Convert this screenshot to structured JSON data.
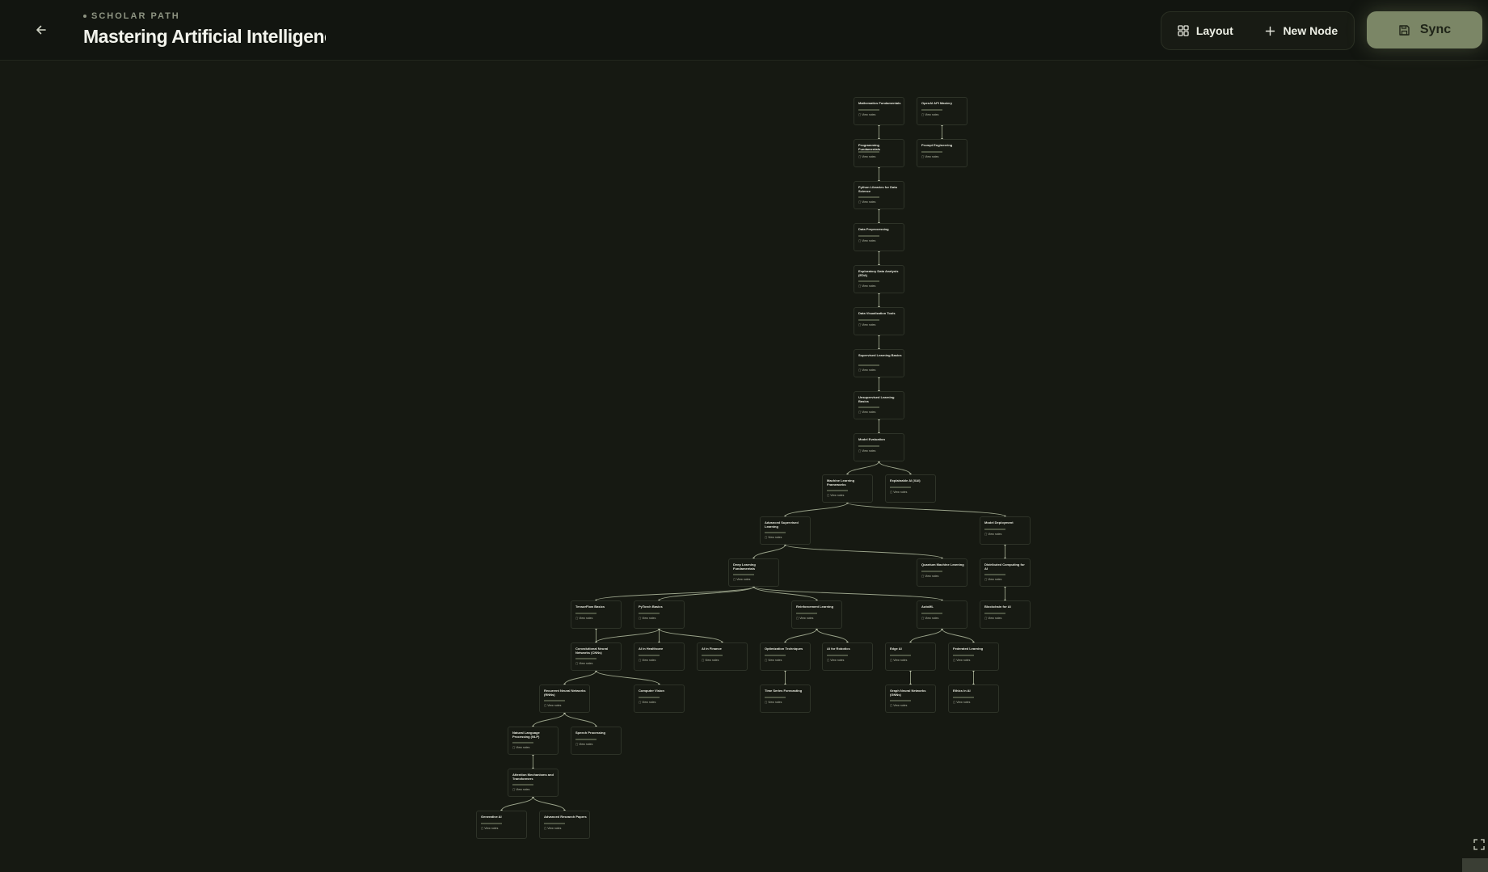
{
  "header": {
    "eyebrow": "SCHOLAR PATH",
    "title": "Mastering Artificial Intelligence",
    "layout_label": "Layout",
    "new_node_label": "New Node",
    "sync_label": "Sync"
  },
  "colors": {
    "background": "#161912",
    "accent": "#7b8666",
    "edge": "#9aa38a",
    "node_border": "#2e3328"
  },
  "icons": {
    "back": "arrow-left-icon",
    "layout": "grid-icon",
    "new_node": "plus-icon",
    "sync": "save-icon",
    "fit": "fullscreen-icon"
  },
  "node_link_label": "View notes",
  "nodes": [
    {
      "title": "Mathematics Fundamentals"
    },
    {
      "title": "OpenAI API Mastery"
    },
    {
      "title": "Programming Fundamentals"
    },
    {
      "title": "Prompt Engineering"
    },
    {
      "title": "Python Libraries for Data Science"
    },
    {
      "title": "Data Preprocessing"
    },
    {
      "title": "Exploratory Data Analysis (EDA)"
    },
    {
      "title": "Data Visualization Tools"
    },
    {
      "title": "Supervised Learning Basics"
    },
    {
      "title": "Unsupervised Learning Basics"
    },
    {
      "title": "Model Evaluation"
    },
    {
      "title": "Machine Learning Frameworks"
    },
    {
      "title": "Explainable AI (XAI)"
    },
    {
      "title": "Advanced Supervised Learning"
    },
    {
      "title": "Model Deployment"
    },
    {
      "title": "Deep Learning Fundamentals"
    },
    {
      "title": "Quantum Machine Learning"
    },
    {
      "title": "Distributed Computing for AI"
    },
    {
      "title": "TensorFlow Basics"
    },
    {
      "title": "PyTorch Basics"
    },
    {
      "title": "Reinforcement Learning"
    },
    {
      "title": "AutoML"
    },
    {
      "title": "Blockchain for AI"
    },
    {
      "title": "Convolutional Neural Networks (CNNs)"
    },
    {
      "title": "AI in Healthcare"
    },
    {
      "title": "AI in Finance"
    },
    {
      "title": "Optimization Techniques"
    },
    {
      "title": "AI for Robotics"
    },
    {
      "title": "Edge AI"
    },
    {
      "title": "Federated Learning"
    },
    {
      "title": "Recurrent Neural Networks (RNNs)"
    },
    {
      "title": "Computer Vision"
    },
    {
      "title": "Time Series Forecasting"
    },
    {
      "title": "Graph Neural Networks (GNNs)"
    },
    {
      "title": "Ethics in AI"
    },
    {
      "title": "Natural Language Processing (NLP)"
    },
    {
      "title": "Speech Processing"
    },
    {
      "title": "Attention Mechanisms and Transformers"
    },
    {
      "title": "Generative AI"
    },
    {
      "title": "Advanced Research Papers"
    }
  ]
}
